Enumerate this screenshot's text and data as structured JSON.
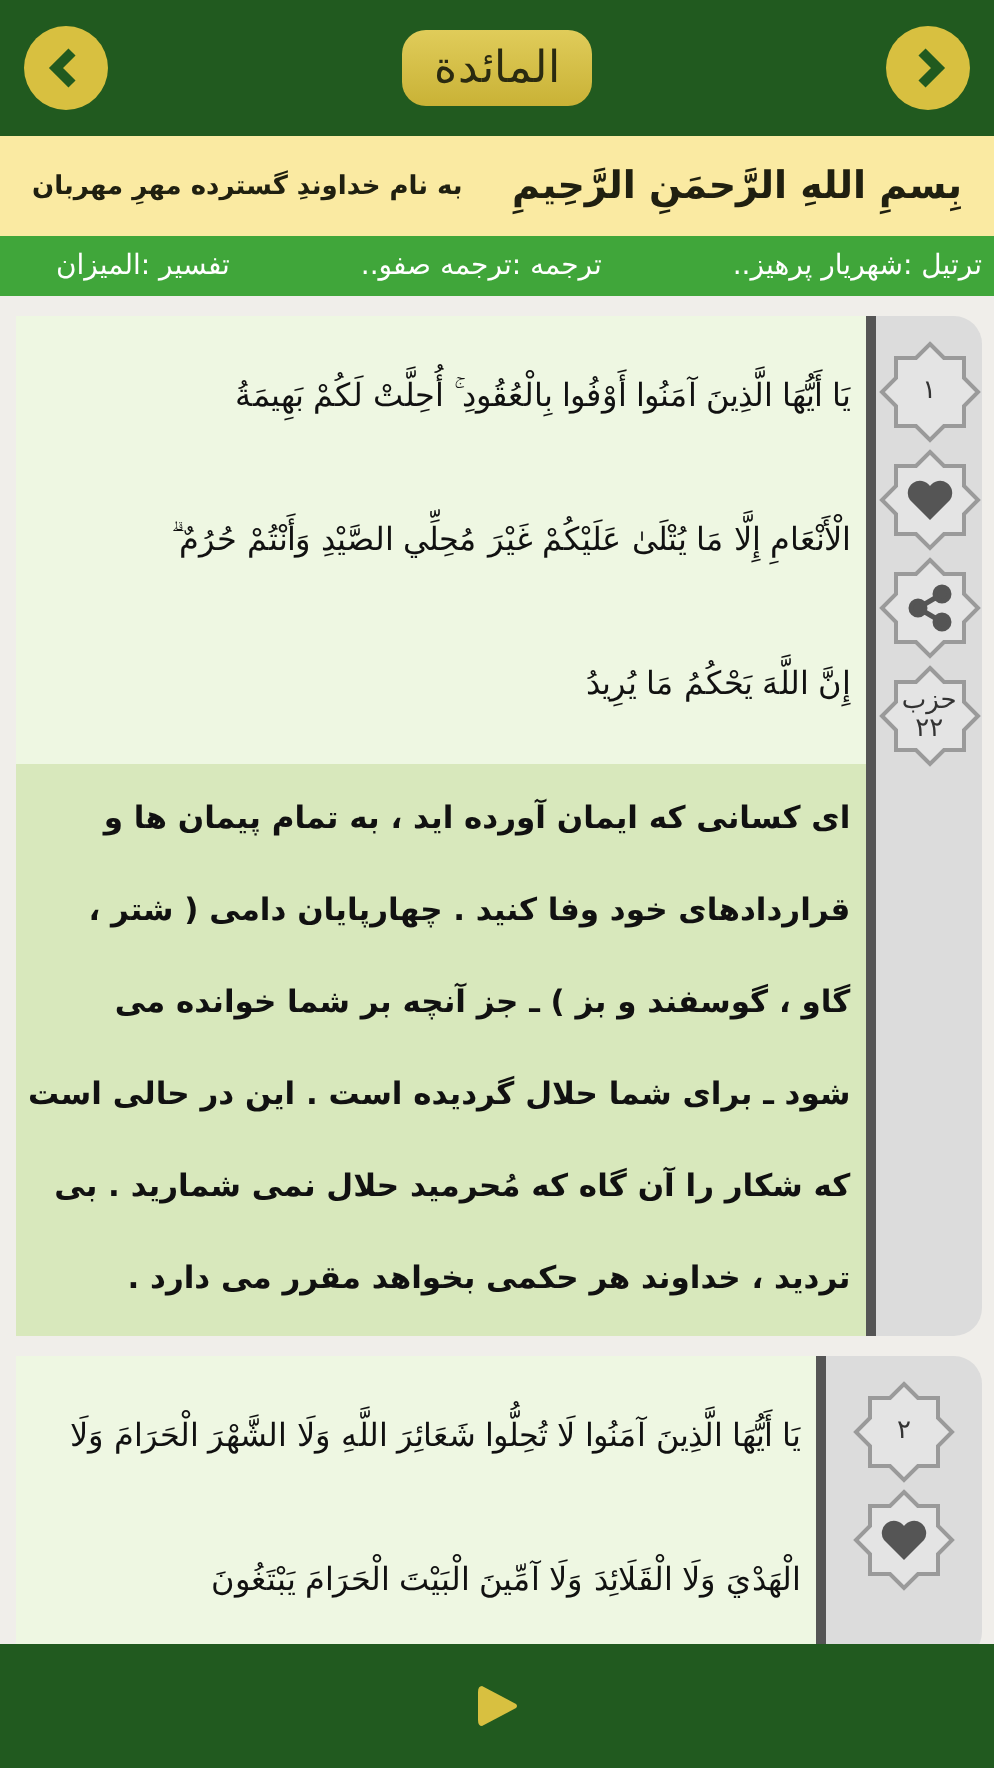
{
  "header": {
    "title": "المائدة"
  },
  "basmala": {
    "arabic": "بِسمِ اللهِ الرَّحمَنِ الرَّحِيمِ",
    "persian": "به نام خداوندِ گسترده مهرِ مهربان"
  },
  "settings_bar": [
    "ترتیل :شهریار پرهیز..",
    "ترجمه :ترجمه صفو..",
    "تفسیر :المیزان"
  ],
  "verses": [
    {
      "number": "١",
      "hizb": {
        "label": "حزب",
        "number": "٢٢"
      },
      "verse_lines": [
        "يَا أَيُّهَا الَّذِينَ آمَنُوا أَوْفُوا بِالْعُقُودِ ۚ أُحِلَّتْ لَكُمْ بَهِيمَةُ",
        "الْأَنْعَامِ إِلَّا مَا يُتْلَىٰ عَلَيْكُمْ غَيْرَ مُحِلِّي الصَّيْدِ وَأَنْتُمْ حُرُمٌ ۗ",
        "إِنَّ اللَّهَ يَحْكُمُ مَا يُرِيدُ"
      ],
      "translation_lines": [
        "ای کسانی که ایمان آورده اید ، به تمام پیمان ها و",
        "قراردادهای خود وفا کنید . چهارپایان دامی ( شتر ،",
        "گاو ، گوسفند و بز ) ـ جز آنچه بر شما خوانده می",
        "شود ـ برای شما حلال گردیده است . این در حالی است",
        "که شکار را آن گاه که مُحرمید حلال نمی شمارید . بی",
        "تردید ، خداوند هر حکمی بخواهد مقرر می دارد ."
      ]
    },
    {
      "number": "٢",
      "verse_lines": [
        "يَا أَيُّهَا الَّذِينَ آمَنُوا لَا تُحِلُّوا شَعَائِرَ اللَّهِ وَلَا الشَّهْرَ الْحَرَامَ وَلَا",
        "الْهَدْيَ وَلَا الْقَلَائِدَ وَلَا آمِّينَ الْبَيْتَ الْحَرَامَ يَبْتَغُونَ"
      ]
    }
  ]
}
